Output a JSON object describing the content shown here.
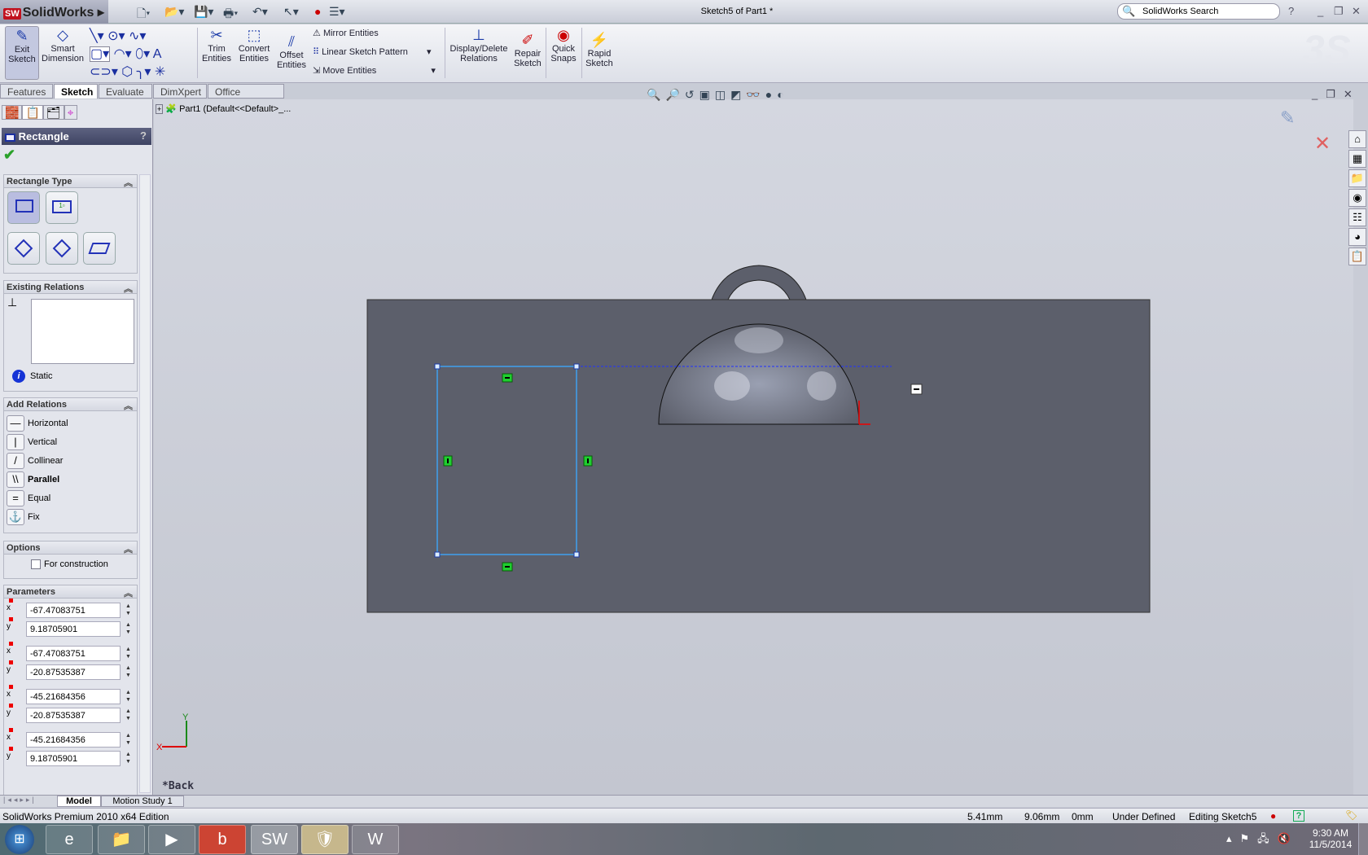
{
  "app": {
    "name": "SolidWorks",
    "logo_mark": "SW",
    "document_title": "Sketch5 of Part1 *",
    "search_placeholder": "SolidWorks Search",
    "help": "?"
  },
  "ribbon": {
    "exit_sketch": "Exit Sketch",
    "smart_dimension": "Smart Dimension",
    "trim_entities": "Trim Entities",
    "convert_entities": "Convert Entities",
    "offset_entities": "Offset Entities",
    "mirror_entities": "Mirror Entities",
    "linear_sketch_pattern": "Linear Sketch Pattern",
    "move_entities": "Move Entities",
    "display_delete_relations": "Display/Delete Relations",
    "repair_sketch": "Repair Sketch",
    "quick_snaps": "Quick Snaps",
    "rapid_sketch": "Rapid Sketch"
  },
  "tabs": [
    {
      "label": "Features"
    },
    {
      "label": "Sketch",
      "active": true
    },
    {
      "label": "Evaluate"
    },
    {
      "label": "DimXpert"
    },
    {
      "label": "Office Products"
    }
  ],
  "tree": {
    "root": "Part1  (Default<<Default>_..."
  },
  "property_manager": {
    "title": "Rectangle",
    "help": "?",
    "rectangle_type": {
      "header": "Rectangle Type"
    },
    "existing_relations": {
      "header": "Existing Relations",
      "status": "Static"
    },
    "add_relations": {
      "header": "Add Relations",
      "items": [
        {
          "label": "Horizontal",
          "icon": "—"
        },
        {
          "label": "Vertical",
          "icon": "|"
        },
        {
          "label": "Collinear",
          "icon": "/"
        },
        {
          "label": "Parallel",
          "icon": "\\\\"
        },
        {
          "label": "Equal",
          "icon": "="
        },
        {
          "label": "Fix",
          "icon": "⚓"
        }
      ]
    },
    "options": {
      "header": "Options",
      "for_construction": "For construction",
      "for_construction_checked": false
    },
    "parameters": {
      "header": "Parameters",
      "values": [
        {
          "axis": "x",
          "value": "-67.47083751"
        },
        {
          "axis": "y",
          "value": "9.18705901"
        },
        {
          "axis": "x",
          "value": "-67.47083751"
        },
        {
          "axis": "y",
          "value": "-20.87535387"
        },
        {
          "axis": "x",
          "value": "-45.21684356"
        },
        {
          "axis": "y",
          "value": "-20.87535387"
        },
        {
          "axis": "x",
          "value": "-45.21684356"
        },
        {
          "axis": "y",
          "value": "9.18705901"
        }
      ]
    }
  },
  "viewport": {
    "view_label": "*Back",
    "triad_x": "X",
    "triad_y": "Y"
  },
  "model_tabs": [
    {
      "label": "Model"
    },
    {
      "label": "Motion Study 1"
    }
  ],
  "status": {
    "edition": "SolidWorks Premium 2010 x64 Edition",
    "x": "5.41mm",
    "y": "9.06mm",
    "z": "0mm",
    "state": "Under Defined",
    "editing": "Editing Sketch5"
  },
  "taskbar": {
    "time": "9:30 AM",
    "date": "11/5/2014"
  },
  "colors": {
    "sketch_line": "#3ea0f0",
    "sheet": "#5c5f6b",
    "relation_glyph": "#1fcf2f",
    "sw_red": "#c1121f"
  }
}
